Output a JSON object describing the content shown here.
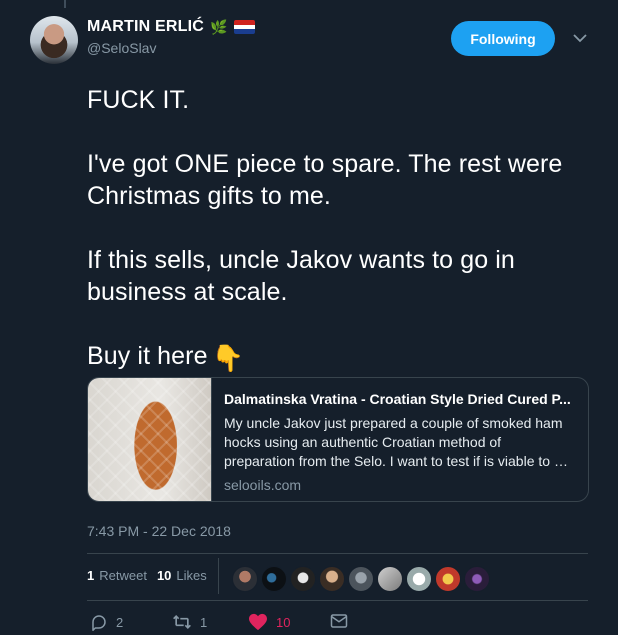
{
  "tweet": {
    "author_name": "MARTIN ERLIĆ",
    "handle": "@SeloSlav",
    "follow_label": "Following",
    "text": "FUCK IT.\n\nI've got ONE piece to spare. The rest were Christmas gifts to me.\n\nIf this sells, uncle Jakov wants to go in business at scale.\n\nBuy it here",
    "badge_icons": [
      "olive-branch-icon",
      "croatian-flag-icon"
    ],
    "pointing_emoji": "👇",
    "timestamp": "7:43 PM - 22 Dec 2018"
  },
  "card": {
    "title": "Dalmatinska Vratina - Croatian Style Dried Cured P...",
    "description": "My uncle Jakov just prepared a couple of smoked ham hocks using an authentic Croatian method of preparation from the Selo. I want to test if is viable to do busines...",
    "domain": "selooils.com"
  },
  "stats": {
    "retweet_count": "1",
    "retweet_label": "Retweet",
    "like_count": "10",
    "like_label": "Likes"
  },
  "actions": {
    "reply_count": "2",
    "retweet_count": "1",
    "like_count": "10"
  },
  "colors": {
    "background": "#151f2b",
    "accent": "#1da1f2",
    "like": "#e0245e",
    "muted": "#8899a6"
  }
}
